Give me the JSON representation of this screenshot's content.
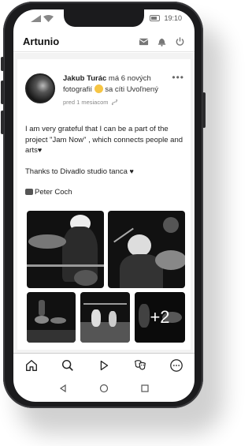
{
  "status_bar": {
    "time": "19:10"
  },
  "app": {
    "title": "Artunio"
  },
  "post": {
    "author": "Jakub Turác",
    "action": "má 6 nových fotografií",
    "feeling": "sa cíti Uvoľnený",
    "timestamp": "pred 1 mesiacom",
    "text_line_1": "I am very grateful that I can be a part of the project \"Jam Now\" , which connects people and arts",
    "text_line_2": "Thanks to Divadlo studio tanca",
    "credit": "Peter Coch",
    "more_photos": "+2"
  },
  "icons": {
    "appbar": [
      "mail-icon",
      "bell-icon",
      "power-icon"
    ],
    "bottom_nav": [
      "home-icon",
      "search-icon",
      "play-icon",
      "theater-masks-icon",
      "more-icon"
    ],
    "system_nav": [
      "back-icon",
      "home-circle-icon",
      "recents-icon"
    ]
  }
}
